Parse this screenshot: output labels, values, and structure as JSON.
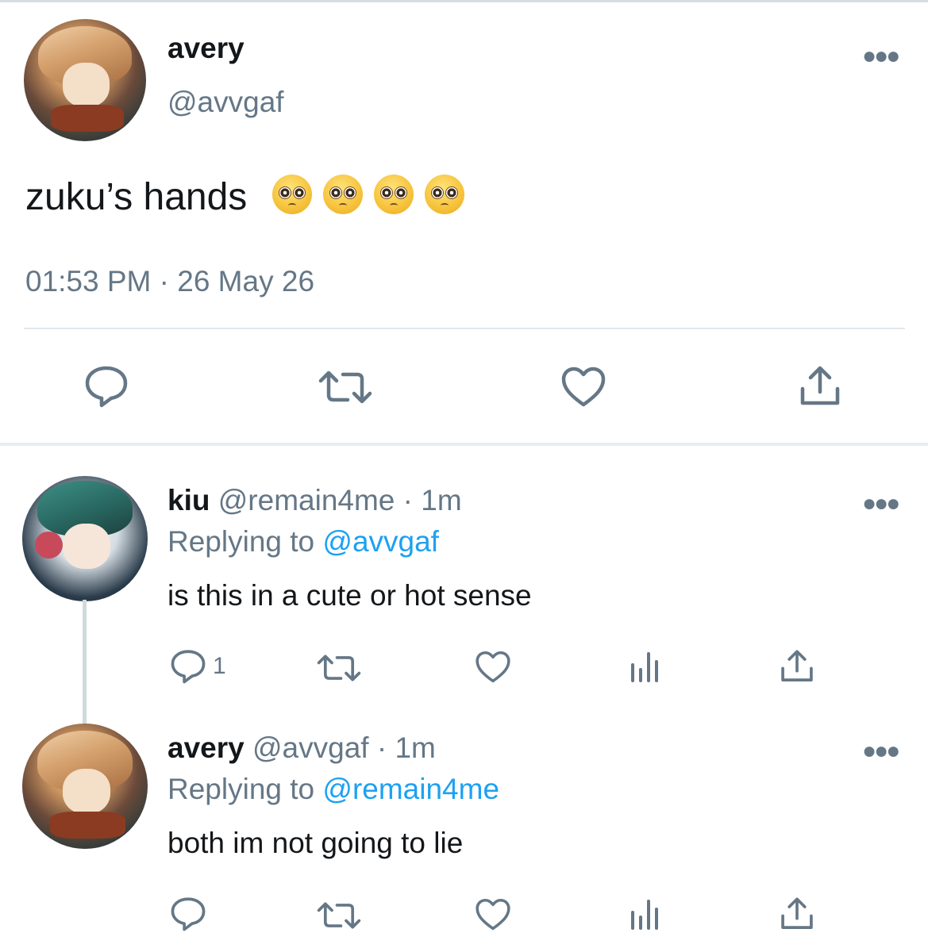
{
  "main_tweet": {
    "author": {
      "display_name": "avery",
      "handle": "@avvgaf"
    },
    "text": "zuku’s hands",
    "emoji": [
      "pleading-face",
      "pleading-face",
      "pleading-face",
      "pleading-face"
    ],
    "timestamp": "01:53 PM · 26 May 26",
    "actions": [
      "reply-icon",
      "retweet-icon",
      "like-icon",
      "share-icon"
    ]
  },
  "replies": [
    {
      "display_name": "kiu",
      "meta": "@remain4me · 1m",
      "replying_prefix": "Replying to ",
      "replying_to": "@avvgaf",
      "text": "is this in a cute or hot sense",
      "reply_count": "1",
      "actions": [
        "reply-icon",
        "retweet-icon",
        "like-icon",
        "analytics-icon",
        "share-icon"
      ]
    },
    {
      "display_name": "avery",
      "meta": "@avvgaf · 1m",
      "replying_prefix": "Replying to ",
      "replying_to": "@remain4me",
      "text": "both im not going to lie",
      "reply_count": "",
      "actions": [
        "reply-icon",
        "retweet-icon",
        "like-icon",
        "analytics-icon",
        "share-icon"
      ]
    }
  ],
  "colors": {
    "text": "#14171a",
    "secondary": "#657786",
    "link": "#1da1f2",
    "divider": "#e1e8ed"
  }
}
